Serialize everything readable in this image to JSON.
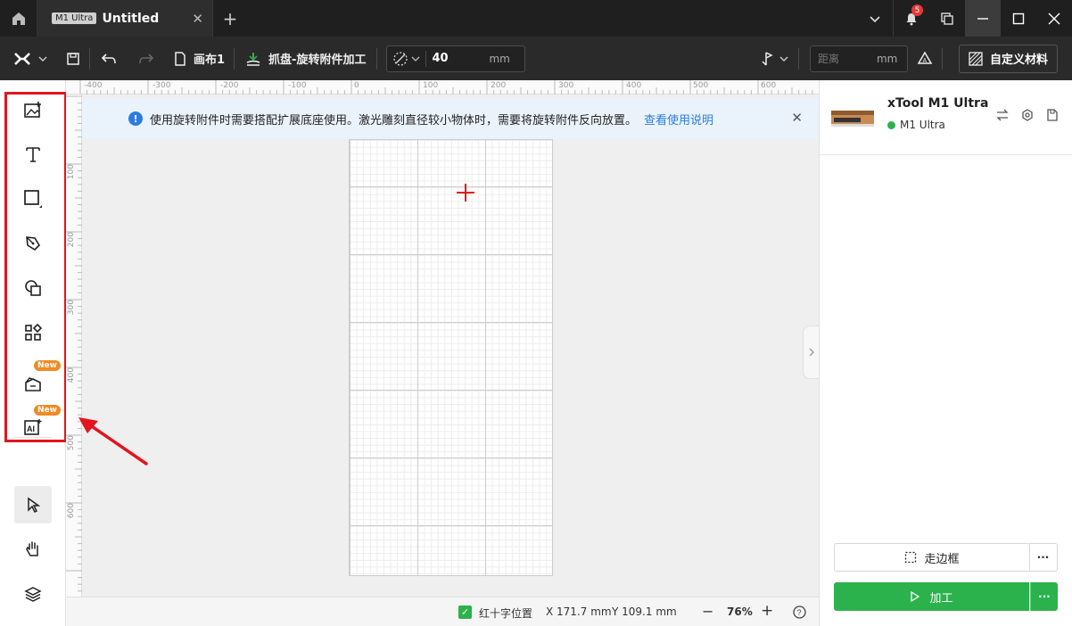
{
  "titlebar": {
    "tab_badge": "M1 Ultra",
    "tab_title": "Untitled",
    "tab_close": "✕",
    "tab_add": "+",
    "notification_count": "5"
  },
  "toolbar": {
    "canvas_name": "画布1",
    "mode_label": "抓盘-旋转附件加工",
    "diameter_value": "40",
    "diameter_unit": "mm",
    "distance_placeholder": "距离",
    "distance_unit": "mm",
    "material_button": "自定义材料"
  },
  "leftbar": {
    "new_badge_1": "New",
    "new_badge_2": "New"
  },
  "rulers": {
    "top": [
      "-400",
      "-300",
      "-200",
      "-100",
      "0",
      "100",
      "200",
      "300",
      "400",
      "500",
      "600"
    ],
    "left": [
      "100",
      "200",
      "300",
      "400",
      "500",
      "600"
    ]
  },
  "banner": {
    "message": "使用旋转附件时需要搭配扩展底座使用。激光雕刻直径较小物体时，需要将旋转附件反向放置。",
    "link": "查看使用说明",
    "icon": "!",
    "close": "✕"
  },
  "statusbar": {
    "crosshair_label": "红十字位置",
    "x_value": "X 171.7 mm",
    "y_value": "Y 109.1 mm",
    "zoom": "76%",
    "minus": "−",
    "plus": "+"
  },
  "device": {
    "name": "xTool M1 Ultra",
    "status": "M1 Ultra"
  },
  "actions": {
    "frame_label": "走边框",
    "process_label": "加工",
    "more": "···"
  },
  "colors": {
    "accent_green": "#2bb24c",
    "highlight_red": "#e3141d",
    "link_blue": "#2d7ce0",
    "badge_orange": "#f08a24"
  }
}
